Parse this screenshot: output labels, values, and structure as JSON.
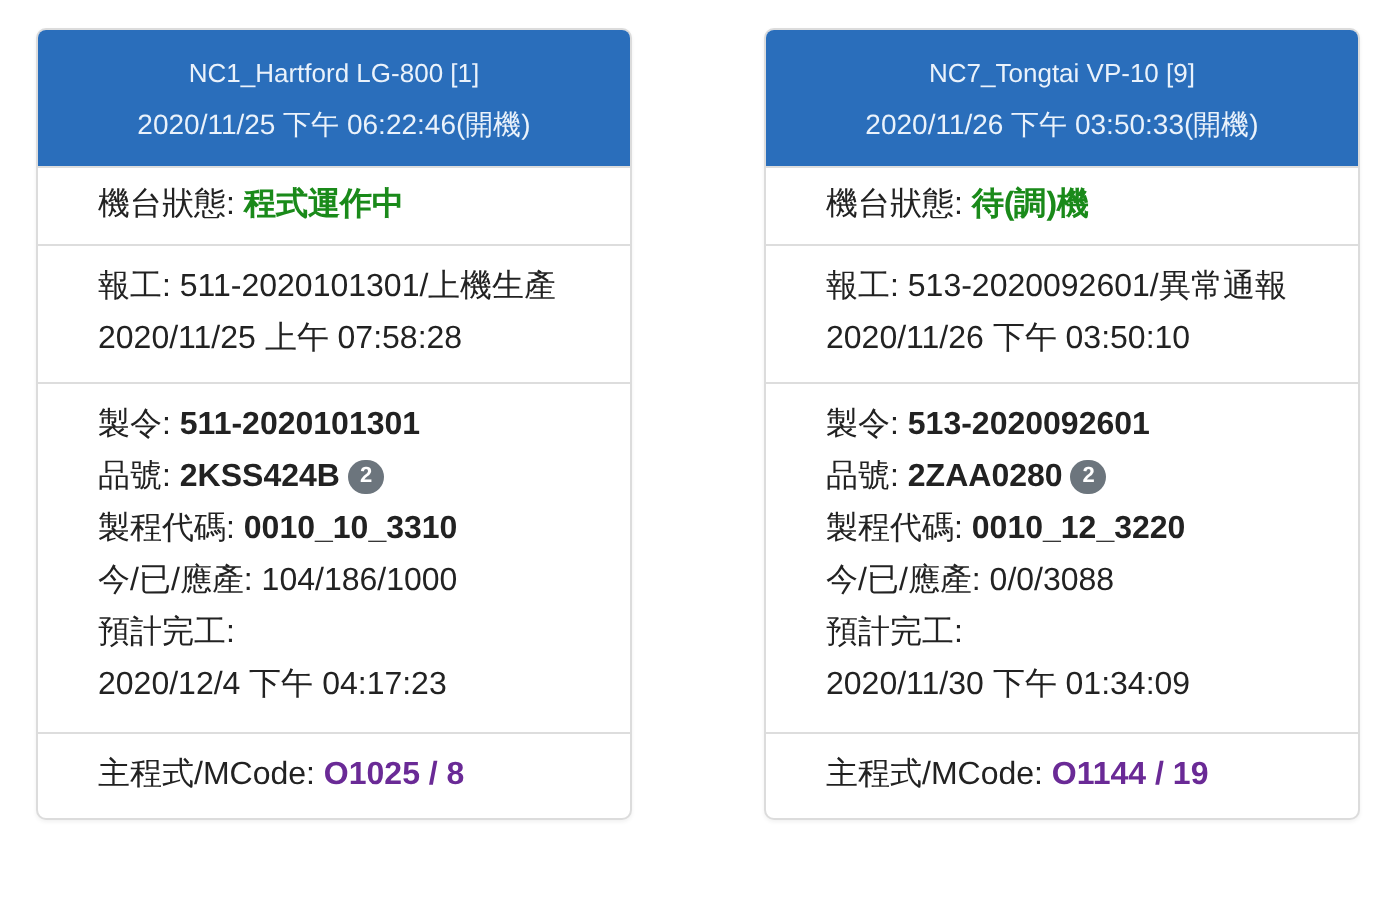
{
  "cards": [
    {
      "title": "NC1_Hartford LG-800 [1]",
      "timestamp": "2020/11/25 下午 06:22:46(開機)",
      "status": {
        "label": "機台狀態:",
        "value": "程式運作中"
      },
      "report": "報工: 511-2020101301/上機生產 2020/11/25 上午 07:58:28",
      "details": [
        {
          "kind": "bold",
          "label": "製令:",
          "value": "511-2020101301"
        },
        {
          "kind": "bold",
          "label": "品號:",
          "value": "2KSS424B",
          "badge": "2"
        },
        {
          "kind": "bold",
          "label": "製程代碼:",
          "value": "0010_10_3310"
        },
        {
          "kind": "plain",
          "label": "今/已/應產:",
          "value": "104/186/1000"
        },
        {
          "kind": "stacked",
          "label": "預計完工:",
          "value": "2020/12/4 下午 04:17:23"
        }
      ],
      "footer": {
        "label": "主程式/MCode:",
        "value": "O1025 / 8"
      }
    },
    {
      "title": "NC7_Tongtai VP-10 [9]",
      "timestamp": "2020/11/26 下午 03:50:33(開機)",
      "status": {
        "label": "機台狀態:",
        "value": "待(調)機"
      },
      "report": "報工: 513-2020092601/異常通報 2020/11/26 下午 03:50:10",
      "details": [
        {
          "kind": "bold",
          "label": "製令:",
          "value": "513-2020092601"
        },
        {
          "kind": "bold",
          "label": "品號:",
          "value": "2ZAA0280",
          "badge": "2"
        },
        {
          "kind": "bold",
          "label": "製程代碼:",
          "value": "0010_12_3220"
        },
        {
          "kind": "plain",
          "label": "今/已/應產:",
          "value": "0/0/3088"
        },
        {
          "kind": "stacked",
          "label": "預計完工:",
          "value": "2020/11/30 下午 01:34:09"
        }
      ],
      "footer": {
        "label": "主程式/MCode:",
        "value": "O1144 / 19"
      }
    }
  ]
}
